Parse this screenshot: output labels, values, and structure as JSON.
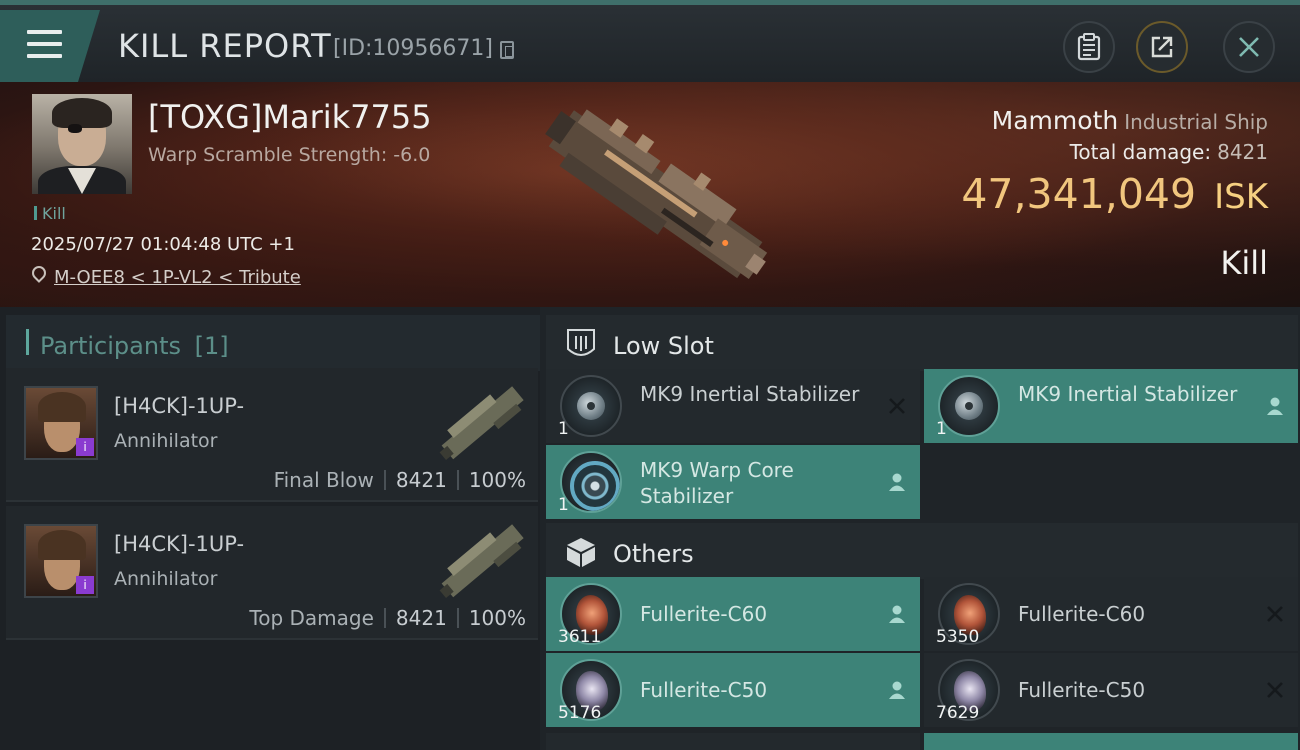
{
  "header": {
    "title": "KILL REPORT",
    "report_id": "[ID:10956671]",
    "buttons": {
      "menu": "menu-icon",
      "clipboard": "clipboard-icon",
      "share": "share-icon",
      "close": "close-icon"
    }
  },
  "victim": {
    "pilot": "[TOXG]Marik7755",
    "scramble": "Warp Scramble Strength: -6.0",
    "tag": "Kill",
    "time": "2025/07/27 01:04:48 UTC +1",
    "location": "M-OEE8 < 1P-VL2 < Tribute",
    "ship": "Mammoth",
    "ship_class": "Industrial Ship",
    "total_damage_label": "Total damage:",
    "total_damage": "8421",
    "isk_value": "47,341,049",
    "isk_unit": "ISK",
    "result": "Kill"
  },
  "participants": {
    "label": "Participants",
    "count": "[1]",
    "rows": [
      {
        "name": "[H4CK]-1UP-",
        "ship": "Annihilator",
        "role": "Final Blow",
        "damage": "8421",
        "percent": "100%"
      },
      {
        "name": "[H4CK]-1UP-",
        "ship": "Annihilator",
        "role": "Top Damage",
        "damage": "8421",
        "percent": "100%"
      }
    ]
  },
  "fitting": {
    "low_slot_label": "Low Slot",
    "others_label": "Others",
    "low_slot": [
      {
        "name": "MK9 Inertial Stabilizer",
        "qty": "1",
        "status": "destroyed",
        "icon": "inertial-stabilizer-icon"
      },
      {
        "name": "MK9 Inertial Stabilizer",
        "qty": "1",
        "status": "dropped",
        "icon": "inertial-stabilizer-icon"
      },
      {
        "name": "MK9 Warp Core Stabilizer",
        "qty": "1",
        "status": "dropped",
        "icon": "warp-core-stabilizer-icon"
      }
    ],
    "others": [
      {
        "name": "Fullerite-C60",
        "qty": "3611",
        "status": "dropped",
        "icon": "fullerite-c60-icon"
      },
      {
        "name": "Fullerite-C60",
        "qty": "5350",
        "status": "destroyed",
        "icon": "fullerite-c60-icon"
      },
      {
        "name": "Fullerite-C50",
        "qty": "5176",
        "status": "dropped",
        "icon": "fullerite-c50-icon"
      },
      {
        "name": "Fullerite-C50",
        "qty": "7629",
        "status": "destroyed",
        "icon": "fullerite-c50-icon"
      }
    ]
  },
  "colors": {
    "accent": "#3d8378",
    "isk": "#f1c67e",
    "participant_badge": "#8a3bd0"
  }
}
